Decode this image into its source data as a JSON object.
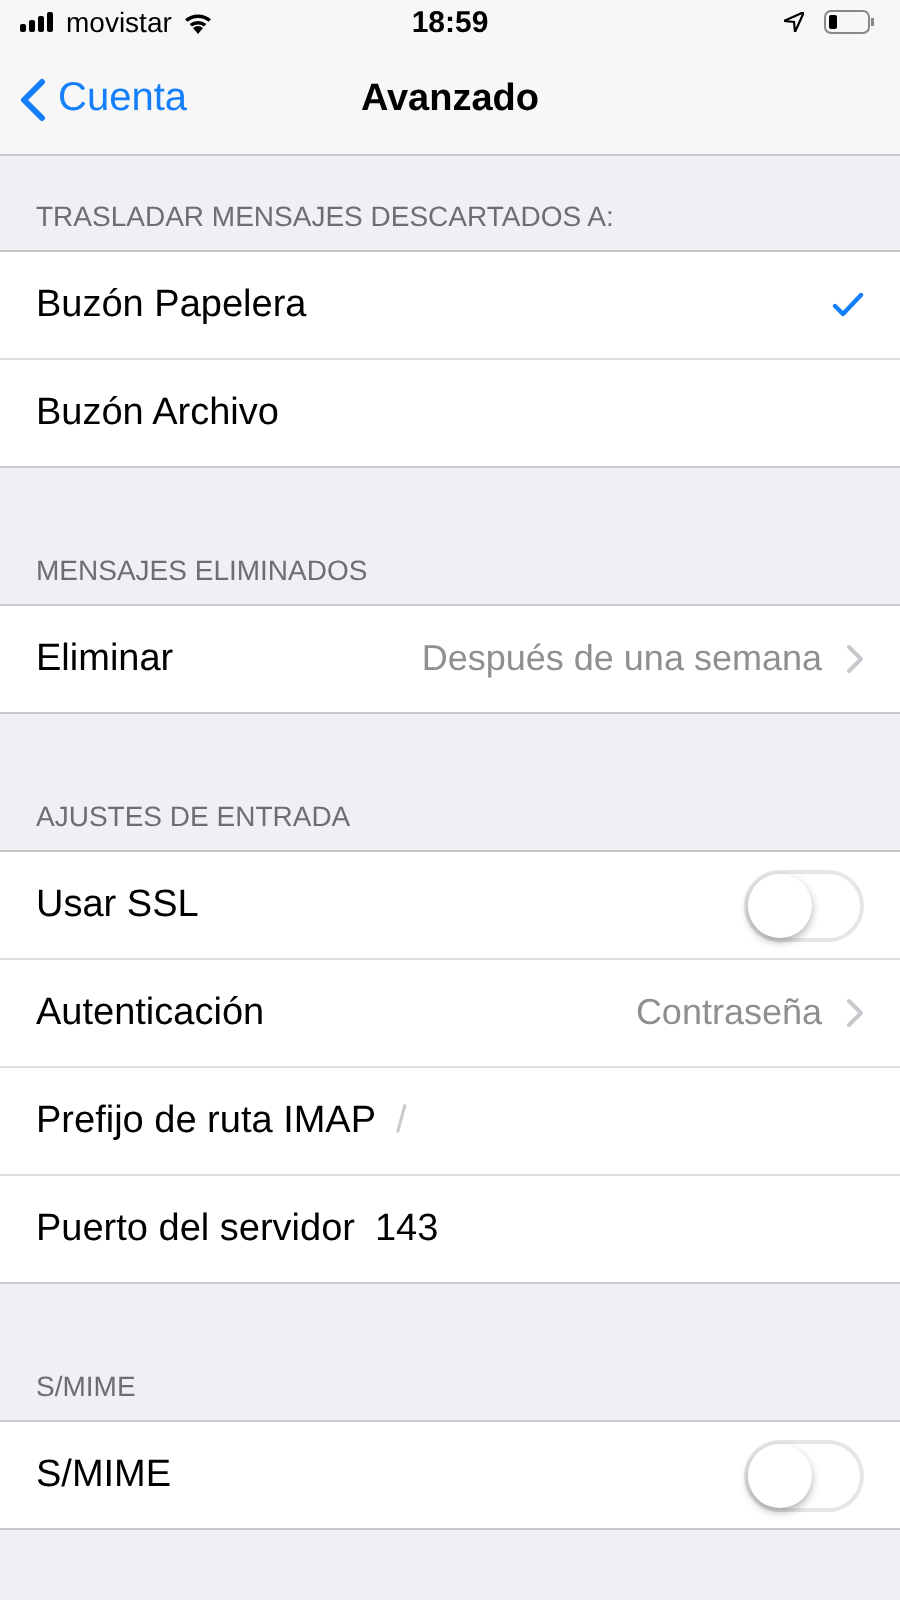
{
  "status_bar": {
    "carrier": "movistar",
    "time": "18:59"
  },
  "nav": {
    "back": "Cuenta",
    "title": "Avanzado"
  },
  "sections": [
    {
      "header": "TRASLADAR MENSAJES DESCARTADOS A:",
      "rows": [
        {
          "kind": "check",
          "label": "Buzón Papelera",
          "selected": true
        },
        {
          "kind": "check",
          "label": "Buzón Archivo",
          "selected": false
        }
      ]
    },
    {
      "header": "MENSAJES ELIMINADOS",
      "rows": [
        {
          "kind": "value",
          "label": "Eliminar",
          "value": "Después de una semana"
        }
      ]
    },
    {
      "header": "AJUSTES DE ENTRADA",
      "rows": [
        {
          "kind": "toggle",
          "label": "Usar SSL",
          "on": false
        },
        {
          "kind": "value",
          "label": "Autenticación",
          "value": "Contraseña"
        },
        {
          "kind": "field",
          "label": "Prefijo de ruta IMAP",
          "placeholder": "/"
        },
        {
          "kind": "field",
          "label": "Puerto del servidor",
          "value": "143"
        }
      ]
    },
    {
      "header": "S/MIME",
      "rows": [
        {
          "kind": "toggle",
          "label": "S/MIME",
          "on": false
        }
      ]
    }
  ]
}
